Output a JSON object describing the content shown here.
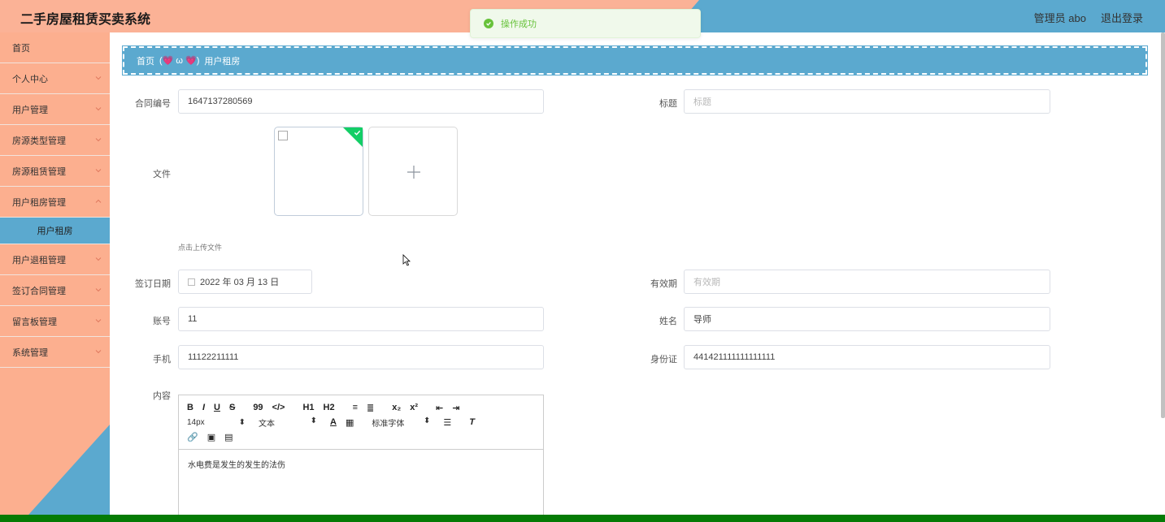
{
  "header": {
    "title": "二手房屋租赁买卖系统",
    "user": "管理员 abo",
    "logout": "退出登录"
  },
  "toast": {
    "message": "操作成功"
  },
  "sidebar": {
    "items": [
      {
        "label": "首页"
      },
      {
        "label": "个人中心"
      },
      {
        "label": "用户管理"
      },
      {
        "label": "房源类型管理"
      },
      {
        "label": "房源租赁管理"
      },
      {
        "label": "用户租房管理"
      },
      {
        "label": "用户租房"
      },
      {
        "label": "用户退租管理"
      },
      {
        "label": "签订合同管理"
      },
      {
        "label": "留言板管理"
      },
      {
        "label": "系统管理"
      }
    ]
  },
  "breadcrumb": {
    "home": "首页",
    "separator": "(💗 ω 💗)",
    "current": "用户租房"
  },
  "form": {
    "contract_no": {
      "label": "合同编号",
      "value": "1647137280569"
    },
    "title": {
      "label": "标题",
      "placeholder": "标题"
    },
    "file": {
      "label": "文件",
      "hint": "点击上传文件"
    },
    "sign_date": {
      "label": "签订日期",
      "value": "2022 年 03 月 13 日"
    },
    "validity": {
      "label": "有效期",
      "placeholder": "有效期"
    },
    "account": {
      "label": "账号",
      "value": "11"
    },
    "name": {
      "label": "姓名",
      "value": "导师"
    },
    "phone": {
      "label": "手机",
      "value": "11122211111"
    },
    "id_card": {
      "label": "身份证",
      "value": "441421111111111111"
    },
    "content": {
      "label": "内容",
      "value": "水电费是发生的发生的法伤"
    }
  },
  "editor": {
    "row1": [
      "B",
      "I",
      "U",
      "S",
      "99",
      "</>",
      "H1",
      "H2",
      "≡",
      "≣",
      "x₂",
      "x²",
      "⇤",
      "⇥"
    ],
    "font_size": "14px",
    "text_style": "文本",
    "font_family": "标准字体"
  },
  "colors": {
    "accent": "#5ba9cf",
    "salmon": "#fbb296",
    "success": "#67c23a",
    "footer": "#057b05"
  }
}
